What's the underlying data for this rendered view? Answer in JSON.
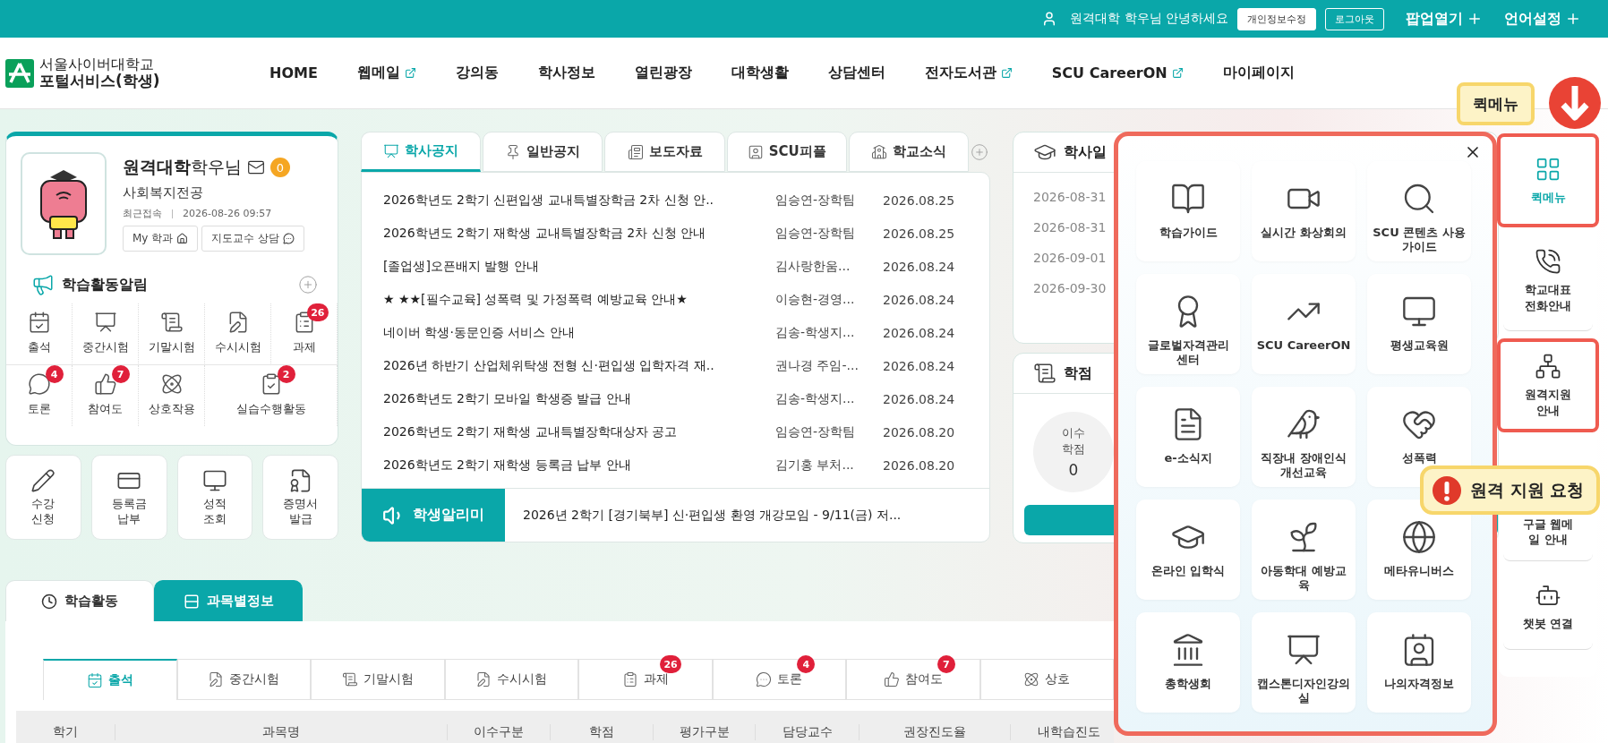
{
  "top_bar": {
    "greeting": "원격대학 학우님 안녕하세요",
    "buttons": [
      "개인정보수정",
      "로그아웃"
    ],
    "menus": [
      "팝업열기",
      "언어설정"
    ]
  },
  "logo": {
    "line1": "서울사이버대학교",
    "line2": "포털서비스(학생)"
  },
  "nav": [
    {
      "label": "HOME",
      "external": false
    },
    {
      "label": "웹메일",
      "external": true
    },
    {
      "label": "강의동",
      "external": false
    },
    {
      "label": "학사정보",
      "external": false
    },
    {
      "label": "열린광장",
      "external": false
    },
    {
      "label": "대학생활",
      "external": false
    },
    {
      "label": "상담센터",
      "external": false
    },
    {
      "label": "전자도서관",
      "external": true
    },
    {
      "label": "SCU CareerON",
      "external": true
    },
    {
      "label": "마이페이지",
      "external": false
    }
  ],
  "profile": {
    "name": "원격대학",
    "suffix": "학우님",
    "mail_count": "0",
    "major": "사회복지전공",
    "last_login_label": "최근접속",
    "last_login": "2026-08-26 09:57",
    "buttons": [
      "My 학과",
      "지도교수 상담"
    ]
  },
  "activity_alerts": {
    "title": "학습활동알림",
    "items": [
      {
        "label": "출석"
      },
      {
        "label": "중간시험"
      },
      {
        "label": "기말시험"
      },
      {
        "label": "수시시험"
      },
      {
        "label": "과제",
        "badge": "26"
      },
      {
        "label": "토론",
        "badge": "4"
      },
      {
        "label": "참여도",
        "badge": "7"
      },
      {
        "label": "상호작용"
      },
      {
        "label": "실습수행활동",
        "badge": "2"
      }
    ]
  },
  "quick_links": [
    "수강 신청",
    "등록금 납부",
    "성적 조회",
    "증명서 발급"
  ],
  "notices": {
    "tabs": [
      {
        "label": "학사공지",
        "selected": true
      },
      {
        "label": "일반공지",
        "selected": false
      },
      {
        "label": "보도자료",
        "selected": false
      },
      {
        "label": "SCU피플",
        "selected": false
      },
      {
        "label": "학교소식",
        "selected": false
      }
    ],
    "rows": [
      {
        "title": "2026학년도 2학기 신편입생 교내특별장학금 2차 신청 안..",
        "author": "임승연-장학팀",
        "date": "2026.08.25"
      },
      {
        "title": "2026학년도 2학기 재학생 교내특별장학금 2차 신청 안내",
        "author": "임승연-장학팀",
        "date": "2026.08.25"
      },
      {
        "title": "[졸업생]오픈배지 발행 안내",
        "author": "김사랑한움...",
        "date": "2026.08.24"
      },
      {
        "title": "★ ★★[필수교육] 성폭력 및 가정폭력 예방교육 안내★",
        "author": "이승현-경영...",
        "date": "2026.08.24"
      },
      {
        "title": "네이버 학생·동문인증 서비스 안내",
        "author": "김송-학생지...",
        "date": "2026.08.24"
      },
      {
        "title": "2026년 하반기 산업체위탁생 전형 신·편입생 입학자격 재..",
        "author": "권나경 주임-...",
        "date": "2026.08.24"
      },
      {
        "title": "2026학년도 2학기 모바일 학생증 발급 안내",
        "author": "김송-학생지...",
        "date": "2026.08.24"
      },
      {
        "title": "2026학년도 2학기 재학생 교내특별장학대상자 공고",
        "author": "임승연-장학팀",
        "date": "2026.08.20"
      },
      {
        "title": "2026학년도 2학기 재학생 등록금 납부 안내",
        "author": "김기홍 부처...",
        "date": "2026.08.20"
      }
    ],
    "ticker": {
      "label": "학생알리미",
      "text": "2026년 2학기 [경기북부] 신·편입생 환영 개강모임 - 9/11(금) 저..."
    }
  },
  "calendar": {
    "title": "학사일",
    "dates": [
      "2026-08-31",
      "2026-08-31",
      "2026-09-01",
      "2026-09-30"
    ]
  },
  "credits": {
    "title": "학점",
    "stat_label": "이수 학점",
    "stat_value": "0"
  },
  "bottom": {
    "tabs": [
      {
        "label": "학습활동",
        "selected": false
      },
      {
        "label": "과목별정보",
        "selected": true
      }
    ],
    "subtabs": [
      {
        "label": "출석",
        "selected": true
      },
      {
        "label": "중간시험",
        "selected": false
      },
      {
        "label": "기말시험",
        "selected": false
      },
      {
        "label": "수시시험",
        "selected": false
      },
      {
        "label": "과제",
        "selected": false,
        "badge": "26"
      },
      {
        "label": "토론",
        "selected": false,
        "badge": "4"
      },
      {
        "label": "참여도",
        "selected": false,
        "badge": "7"
      },
      {
        "label": "상호",
        "selected": false
      }
    ],
    "columns": [
      "학기",
      "과목명",
      "이수구분",
      "학점",
      "평가구분",
      "담당교수",
      "권장진도율",
      "내학습진도"
    ]
  },
  "quick_menu": {
    "items": [
      "학습가이드",
      "실시간 화상회의",
      "SCU 콘텐츠 사용 가이드",
      "글로벌자격관리 센터",
      "SCU CareerON",
      "평생교육원",
      "e-소식지",
      "직장내 장애인식 개선교육",
      "성폭력",
      "온라인 입학식",
      "아동학대 예방교육",
      "메타유니버스",
      "총학생회",
      "캡스톤디자인강의실",
      "나의자격정보"
    ]
  },
  "sidebar": [
    {
      "label": "퀵메뉴",
      "selected": true,
      "highlighted": true
    },
    {
      "label": "학교대표 전화안내",
      "selected": false,
      "highlighted": false
    },
    {
      "label": "원격지원 안내",
      "selected": false,
      "highlighted": true
    },
    {
      "label": "구글 웹메일 안내",
      "selected": false,
      "highlighted": false
    },
    {
      "label": "챗봇 연결",
      "selected": false,
      "highlighted": false
    }
  ],
  "callouts": [
    {
      "kind": "label",
      "text": "퀵메뉴"
    },
    {
      "kind": "arrow"
    },
    {
      "kind": "alert",
      "text": "원격 지원 요청"
    }
  ]
}
